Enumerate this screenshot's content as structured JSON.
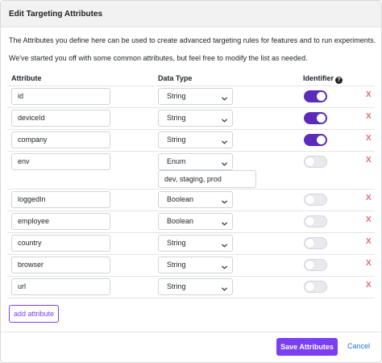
{
  "modal": {
    "title": "Edit Targeting Attributes",
    "intro_line1": "The Attributes you define here can be used to create advanced targeting rules for features and to run experiments.",
    "intro_line2": "We've started you off with some common attributes, but feel free to modify the list as needed."
  },
  "table": {
    "headers": {
      "attribute": "Attribute",
      "data_type": "Data Type",
      "identifier": "Identifier",
      "identifier_help_icon": "?"
    },
    "rows": [
      {
        "attribute": "id",
        "data_type": "String",
        "identifier": true,
        "remove_label": "X"
      },
      {
        "attribute": "deviceId",
        "data_type": "String",
        "identifier": true,
        "remove_label": "X"
      },
      {
        "attribute": "company",
        "data_type": "String",
        "identifier": true,
        "remove_label": "X"
      },
      {
        "attribute": "env",
        "data_type": "Enum",
        "identifier": false,
        "enum_values": "dev, staging, prod",
        "remove_label": "X"
      },
      {
        "attribute": "loggedIn",
        "data_type": "Boolean",
        "identifier": false,
        "remove_label": "X"
      },
      {
        "attribute": "employee",
        "data_type": "Boolean",
        "identifier": false,
        "remove_label": "X"
      },
      {
        "attribute": "country",
        "data_type": "String",
        "identifier": false,
        "remove_label": "X"
      },
      {
        "attribute": "browser",
        "data_type": "String",
        "identifier": false,
        "remove_label": "X"
      },
      {
        "attribute": "url",
        "data_type": "String",
        "identifier": false,
        "remove_label": "X"
      }
    ]
  },
  "actions": {
    "add_attribute": "add attribute",
    "save": "Save Attributes",
    "cancel": "Cancel"
  },
  "colors": {
    "accent": "#7b3ff2",
    "toggle_on": "#5b2bb9",
    "remove": "#e06c6c",
    "link": "#1a73e8"
  },
  "icons": {
    "help": "question-circle-icon",
    "select_arrow": "chevron-down-icon",
    "remove": "close-icon"
  }
}
